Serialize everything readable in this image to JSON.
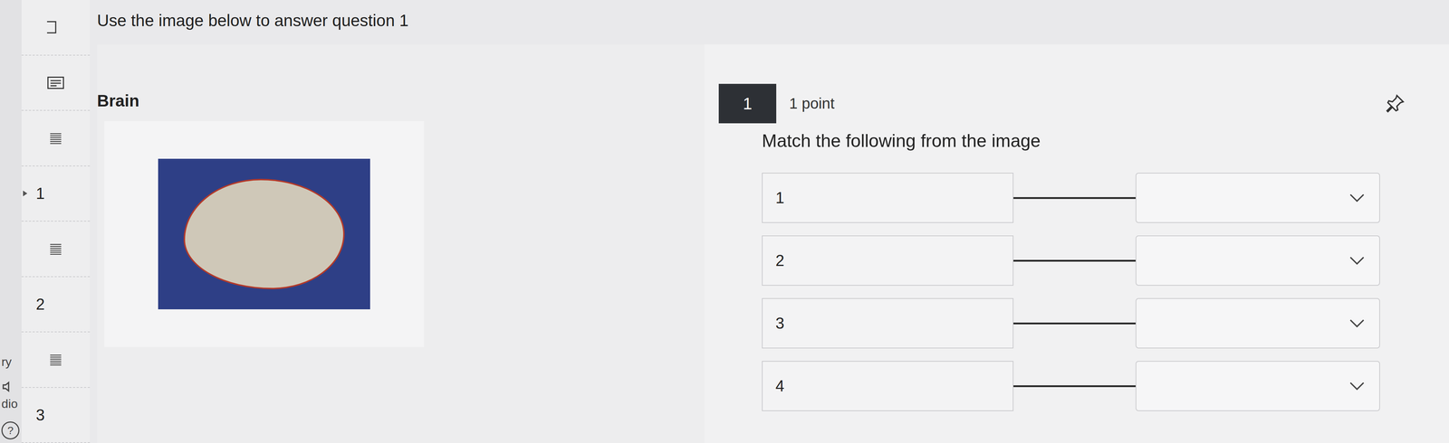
{
  "sidebar": {
    "rail": [
      {
        "kind": "text",
        "label": "ry"
      },
      {
        "kind": "audio",
        "label": "dio"
      },
      {
        "kind": "help",
        "label": "?"
      }
    ],
    "items": [
      {
        "kind": "box",
        "selected": false
      },
      {
        "kind": "doc",
        "selected": false
      },
      {
        "kind": "list",
        "selected": false
      },
      {
        "kind": "number",
        "label": "1",
        "selected": true
      },
      {
        "kind": "list",
        "selected": false
      },
      {
        "kind": "number",
        "label": "2",
        "selected": false
      },
      {
        "kind": "list",
        "selected": false
      },
      {
        "kind": "number",
        "label": "3",
        "selected": false
      }
    ]
  },
  "instruction": "Use the image below to answer question 1",
  "figure": {
    "title": "Brain"
  },
  "question": {
    "number": "1",
    "points": "1 point",
    "prompt": "Match the following from the image",
    "pinned": false,
    "pairs": [
      {
        "label": "1"
      },
      {
        "label": "2"
      },
      {
        "label": "3"
      },
      {
        "label": "4"
      }
    ]
  }
}
